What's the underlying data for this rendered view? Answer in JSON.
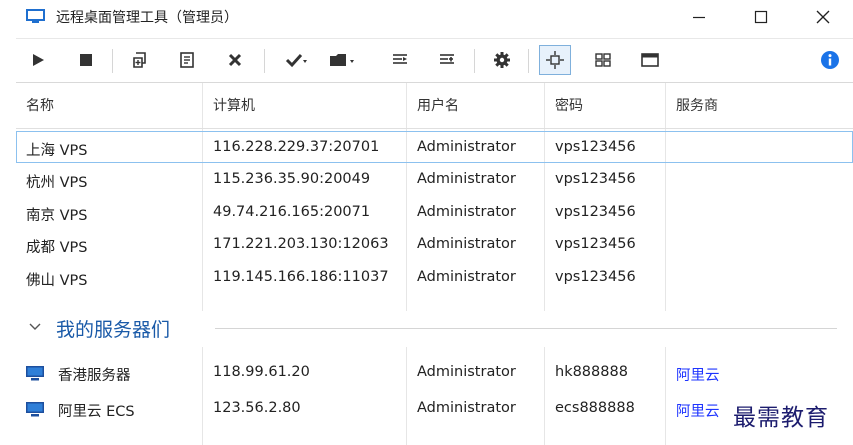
{
  "window": {
    "title": "远程桌面管理工具（管理员）"
  },
  "toolbar": {
    "items": [
      {
        "name": "play-icon",
        "dropdown": false
      },
      {
        "name": "stop-icon",
        "dropdown": false
      },
      {
        "name": "new-connection-icon",
        "dropdown": false
      },
      {
        "name": "properties-icon",
        "dropdown": false
      },
      {
        "name": "delete-icon",
        "dropdown": false
      },
      {
        "name": "check-icon",
        "dropdown": true
      },
      {
        "name": "folder-icon",
        "dropdown": true
      },
      {
        "name": "align-left-icon",
        "dropdown": false
      },
      {
        "name": "align-right-icon",
        "dropdown": false
      },
      {
        "name": "settings-icon",
        "dropdown": false
      },
      {
        "name": "fit-screen-icon",
        "dropdown": false,
        "active": true
      },
      {
        "name": "grid-view-icon",
        "dropdown": false
      },
      {
        "name": "window-icon",
        "dropdown": false
      },
      {
        "name": "info-icon",
        "dropdown": false
      }
    ],
    "accent": "#1a73e8"
  },
  "table": {
    "columns": [
      "名称",
      "计算机",
      "用户名",
      "密码",
      "服务商"
    ],
    "rows": [
      {
        "name": "上海 VPS",
        "computer": "116.228.229.37:20701",
        "user": "Administrator",
        "password": "vps123456",
        "provider": "",
        "selected": true
      },
      {
        "name": "杭州 VPS",
        "computer": "115.236.35.90:20049",
        "user": "Administrator",
        "password": "vps123456",
        "provider": ""
      },
      {
        "name": "南京 VPS",
        "computer": "49.74.216.165:20071",
        "user": "Administrator",
        "password": "vps123456",
        "provider": ""
      },
      {
        "name": "成都 VPS",
        "computer": "171.221.203.130:12063",
        "user": "Administrator",
        "password": "vps123456",
        "provider": ""
      },
      {
        "name": "佛山 VPS",
        "computer": "119.145.166.186:11037",
        "user": "Administrator",
        "password": "vps123456",
        "provider": ""
      }
    ],
    "group": {
      "title": "我的服务器们",
      "rows": [
        {
          "name": "香港服务器",
          "computer": "118.99.61.20",
          "user": "Administrator",
          "password": "hk888888",
          "provider": "阿里云",
          "icon": "monitor-icon"
        },
        {
          "name": "阿里云 ECS",
          "computer": "123.56.2.80",
          "user": "Administrator",
          "password": "ecs888888",
          "provider": "阿里云",
          "icon": "monitor-icon"
        }
      ]
    },
    "link_color": "#1e34ff"
  },
  "watermark": {
    "text": "最需教育"
  }
}
